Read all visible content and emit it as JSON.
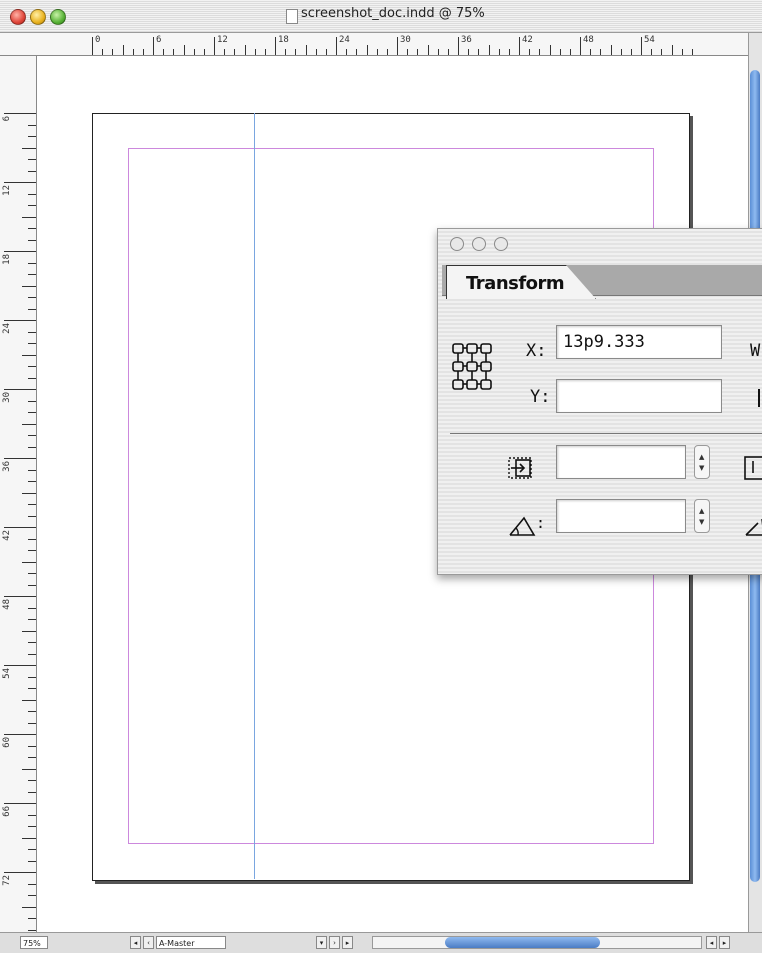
{
  "window": {
    "title": "screenshot_doc.indd @ 75%"
  },
  "ruler": {
    "h_labels": [
      "0",
      "6",
      "12",
      "18",
      "24",
      "30",
      "36",
      "42",
      "48",
      "54"
    ],
    "v_labels": [
      "6",
      "12",
      "18",
      "24",
      "30",
      "36",
      "42",
      "48",
      "54",
      "60",
      "66",
      "72"
    ]
  },
  "transform_panel": {
    "tab_label": "Transform",
    "x_label": "X:",
    "x_value": "13p9.333",
    "y_label": "Y:",
    "y_value": "",
    "w_label": "W",
    "angle_label": "∠:",
    "scale_value": "",
    "rotate_value": ""
  },
  "statusbar": {
    "zoom": "75%",
    "page": "A-Master"
  },
  "colors": {
    "margin_guide": "#cc88dd",
    "column_guide": "#7aa6e0",
    "scroll_thumb": "#5b8fd6"
  }
}
